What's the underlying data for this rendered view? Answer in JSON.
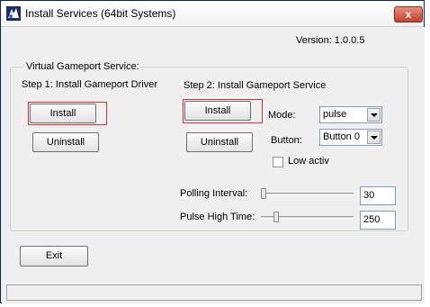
{
  "window": {
    "title": "Install Services (64bit Systems)",
    "close_label": "x"
  },
  "version_text": "Version: 1.0.0.5",
  "group": {
    "label": "Virtual Gameport Service:",
    "step1": {
      "heading": "Step 1: Install Gameport Driver",
      "install_label": "Install",
      "uninstall_label": "Uninstall"
    },
    "step2": {
      "heading": "Step 2: Install Gameport Service",
      "install_label": "Install",
      "uninstall_label": "Uninstall",
      "mode_label": "Mode:",
      "mode_value": "pulse",
      "button_label": "Button:",
      "button_value": "Button 0",
      "low_activ_label": "Low activ",
      "low_activ_checked": false
    },
    "polling": {
      "label": "Polling Interval:",
      "value": "30",
      "slider_fraction": 0.0
    },
    "pulse": {
      "label": "Pulse High Time:",
      "value": "250",
      "slider_fraction": 0.16
    }
  },
  "exit_label": "Exit",
  "status_text": "",
  "colors": {
    "highlight": "#e03030",
    "title_close": "#c4412b"
  }
}
